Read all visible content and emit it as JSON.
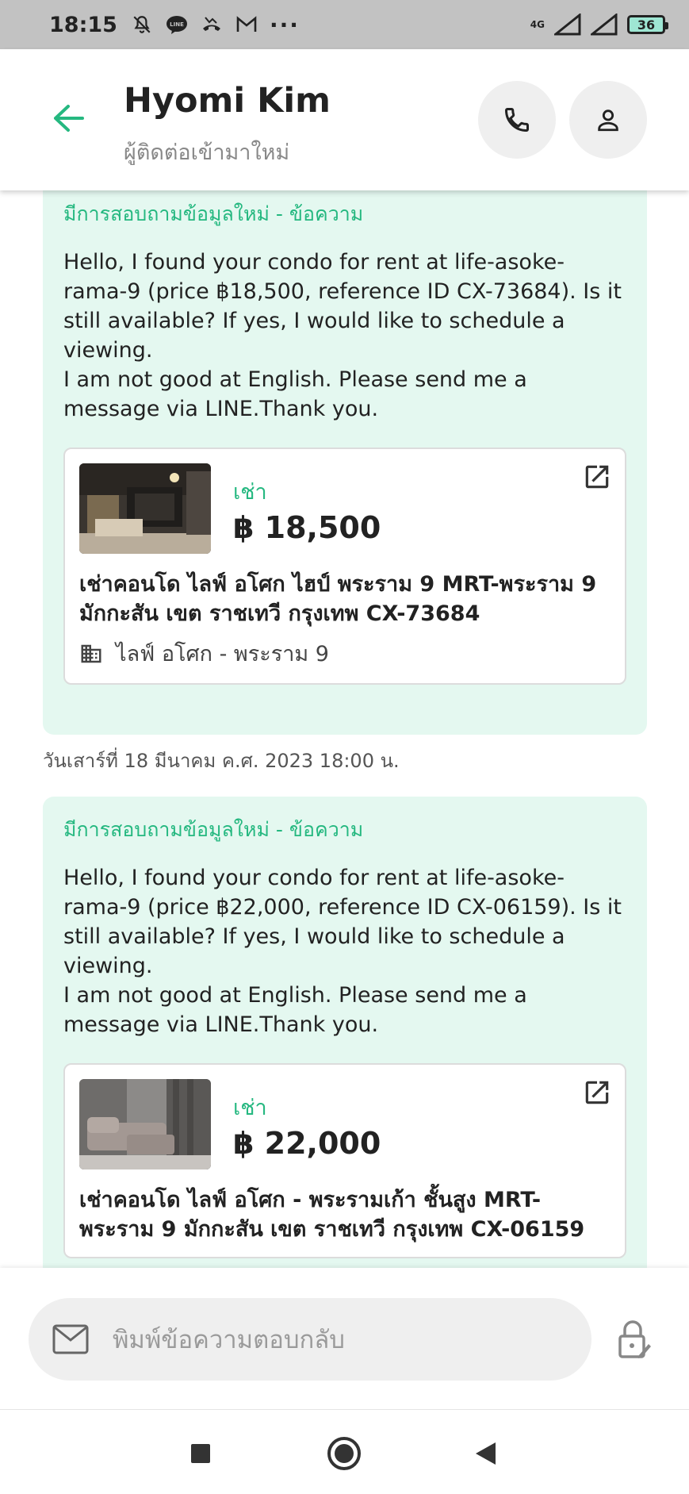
{
  "status_bar": {
    "time": "18:15",
    "more": "···",
    "network": "4G",
    "battery": "36"
  },
  "header": {
    "title": "Hyomi Kim",
    "subtitle": "ผู้ติดต่อเข้ามาใหม่",
    "accent_color": "#25b880"
  },
  "messages": [
    {
      "heading": "มีการสอบถามข้อมูลใหม่ - ข้อความ",
      "text": "Hello, I found your condo for rent at life-asoke-rama-9 (price ฿18,500, reference ID CX-73684). Is it still available? If yes, I would like to schedule a viewing.\nI am not good at English. Please send me a message via LINE.Thank you.",
      "listing": {
        "type": "เช่า",
        "price": "฿ 18,500",
        "title": "เช่าคอนโด  ไลฟ์ อโศก ไฮป์ พระราม 9 MRT-พระราม 9 มักกะสัน เขต ราชเทวี กรุงเทพ CX-73684",
        "location": "ไลฟ์ อโศก - พระราม 9"
      }
    },
    {
      "heading": "มีการสอบถามข้อมูลใหม่ - ข้อความ",
      "text": "Hello, I found your condo for rent at life-asoke-rama-9 (price ฿22,000, reference ID CX-06159). Is it still available? If yes, I would like to schedule a viewing.\nI am not good at English. Please send me a message via LINE.Thank you.",
      "listing": {
        "type": "เช่า",
        "price": "฿ 22,000",
        "title": "เช่าคอนโด  ไลฟ์ อโศก - พระรามเก้า ชั้นสูง MRT-พระราม 9 มักกะสัน เขต ราชเทวี กรุงเทพ CX-06159"
      }
    }
  ],
  "timestamp_1": "วันเสาร์ที่ 18 มีนาคม ค.ศ. 2023 18:00 น.",
  "reply": {
    "placeholder": "พิมพ์ข้อความตอบกลับ"
  }
}
